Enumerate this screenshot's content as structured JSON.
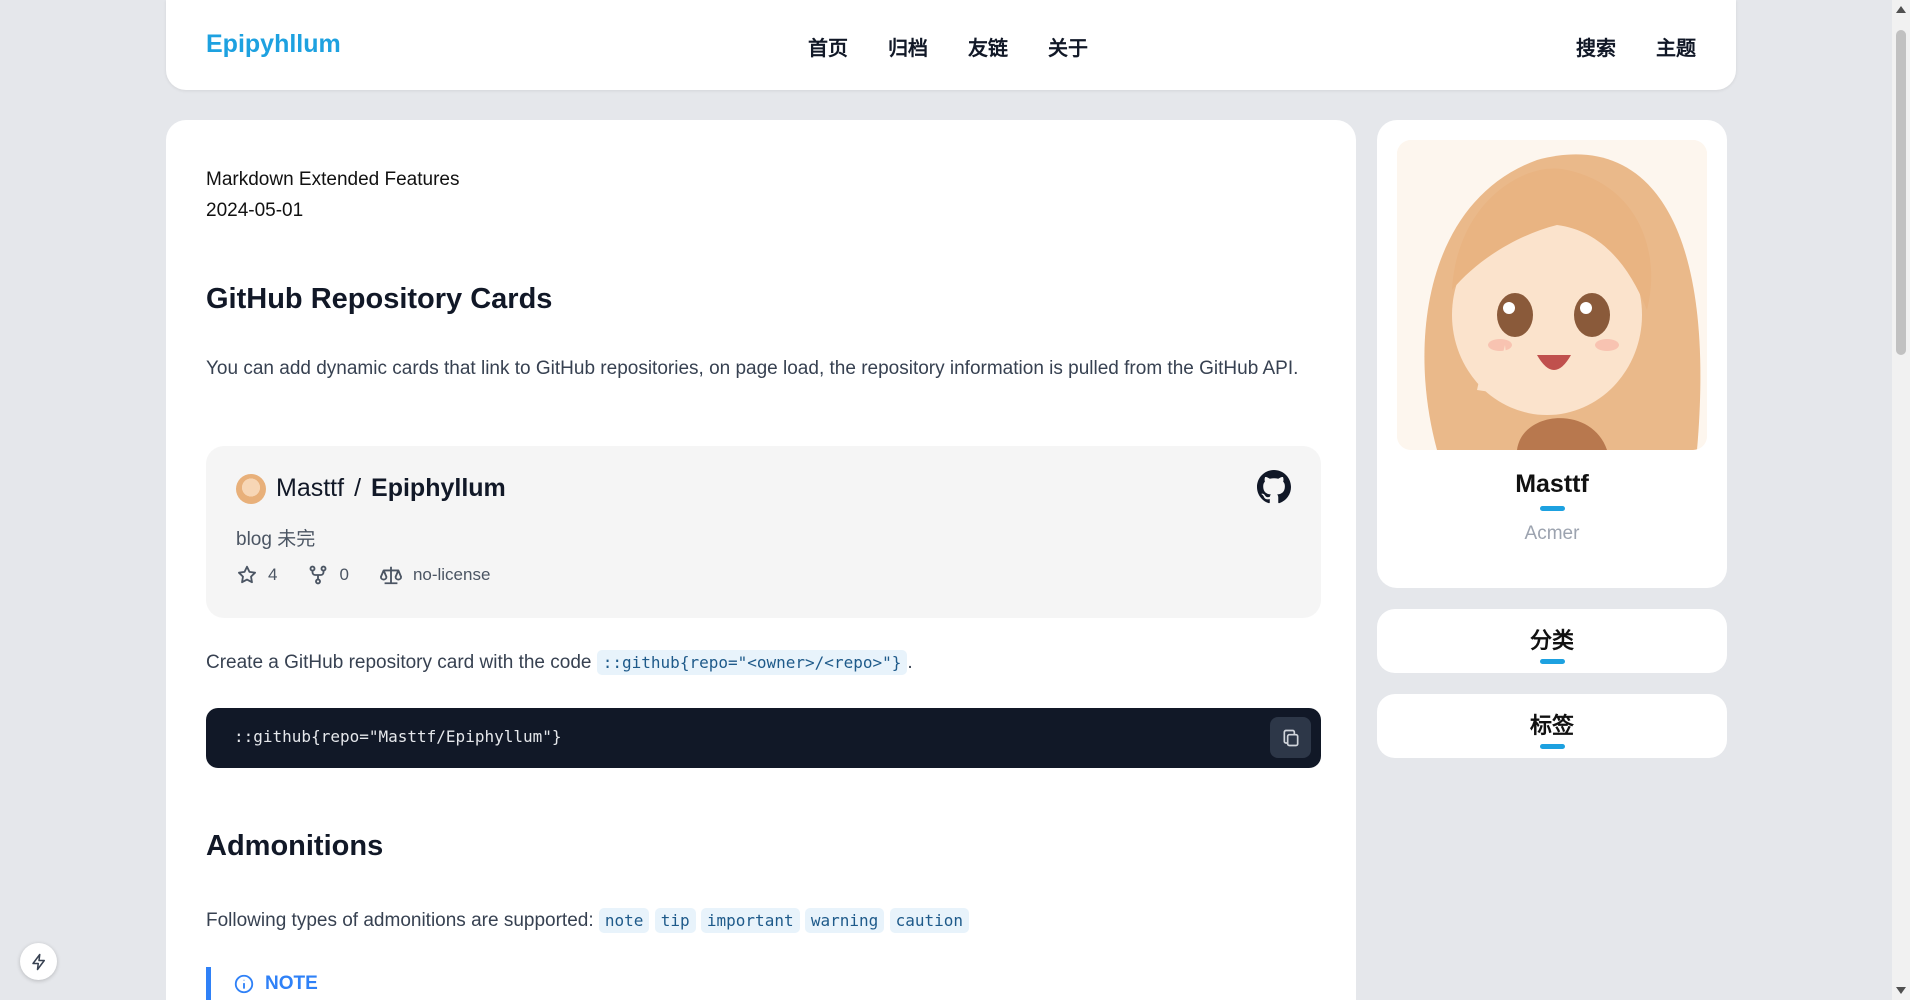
{
  "nav": {
    "brand": "Epipyhllum",
    "links": [
      "首页",
      "归档",
      "友链",
      "关于"
    ],
    "right": [
      "搜索",
      "主题"
    ]
  },
  "post": {
    "title": "Markdown Extended Features",
    "date": "2024-05-01",
    "section1": {
      "heading": "GitHub Repository Cards",
      "intro": "You can add dynamic cards that link to GitHub repositories, on page load, the repository information is pulled from the GitHub API.",
      "repo_card": {
        "owner": "Masttf",
        "separator": "/",
        "repo": "Epiphyllum",
        "description": "blog 未完",
        "stars": "4",
        "forks": "0",
        "license": "no-license"
      },
      "usage_text": "Create a GitHub repository card with the code",
      "usage_code": "::github{repo=\"<owner>/<repo>\"}",
      "usage_end": ".",
      "code_block": "::github{repo=\"Masttf/Epiphyllum\"}"
    },
    "section2": {
      "heading": "Admonitions",
      "intro": "Following types of admonitions are supported:",
      "types": [
        "note",
        "tip",
        "important",
        "warning",
        "caution"
      ],
      "first_label": "NOTE"
    }
  },
  "sidebar": {
    "profile": {
      "name": "Masttf",
      "bio": "Acmer"
    },
    "categories_title": "分类",
    "tags_title": "标签"
  },
  "colors": {
    "accent": "#1da1e0",
    "note": "#2f81f7",
    "code_bg": "#111827"
  }
}
